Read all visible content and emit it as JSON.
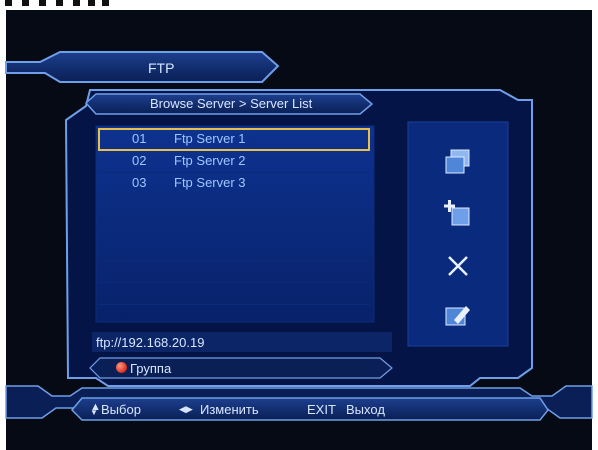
{
  "header": {
    "title": "FTP"
  },
  "panel": {
    "breadcrumb": "Browse Server > Server List"
  },
  "servers": [
    {
      "num": "01",
      "name": "Ftp Server 1",
      "selected": true
    },
    {
      "num": "02",
      "name": "Ftp Server 2",
      "selected": false
    },
    {
      "num": "03",
      "name": "Ftp Server 3",
      "selected": false
    }
  ],
  "path": "ftp://192.168.20.19",
  "actions": [
    {
      "icon": "copy-windows-icon"
    },
    {
      "icon": "add-item-icon"
    },
    {
      "icon": "delete-x-icon"
    },
    {
      "icon": "edit-pencil-icon"
    }
  ],
  "color_key": {
    "red_label": "Группа"
  },
  "footer": {
    "select_label": "Выбор",
    "change_label": "Изменить",
    "exit_key": "EXIT",
    "exit_label": "Выход"
  },
  "colors": {
    "background": "#050a14",
    "panel": "#0b2a80",
    "frame": "#6f9fe8",
    "highlight": "#e6c04a",
    "list_text": "#9bc8ff",
    "red_button": "#e23a2a"
  }
}
